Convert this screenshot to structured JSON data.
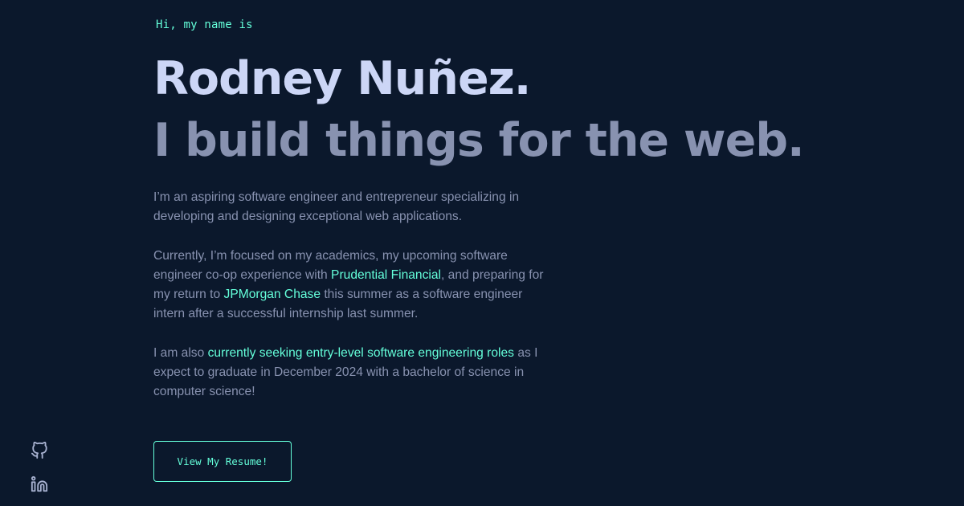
{
  "hero": {
    "greeting": "Hi, my name is",
    "name": "Rodney Nuñez.",
    "tagline": "I build things for the web."
  },
  "bio": {
    "p1": "I’m an aspiring software engineer and entrepreneur specializing in developing and designing exceptional web applications.",
    "p2_a": "Currently, I’m focused on my academics, my upcoming software engineer co-op experience with ",
    "p2_link1": "Prudential Financial",
    "p2_b": ", and preparing for my return to ",
    "p2_link2": "JPMorgan Chase",
    "p2_c": " this summer as a software engineer intern after a successful internship last summer.",
    "p3_a": "I am also ",
    "p3_link": "currently seeking entry-level software engineering roles",
    "p3_b": " as I expect to graduate in December 2024 with a bachelor of science in computer science!"
  },
  "cta": {
    "resume_label": "View My Resume!"
  },
  "social": {
    "icons": [
      "github-icon",
      "linkedin-icon"
    ]
  },
  "colors": {
    "background": "#0b182c",
    "accent": "#64ffda",
    "heading": "#ccd6f6",
    "text": "#8892b0"
  }
}
